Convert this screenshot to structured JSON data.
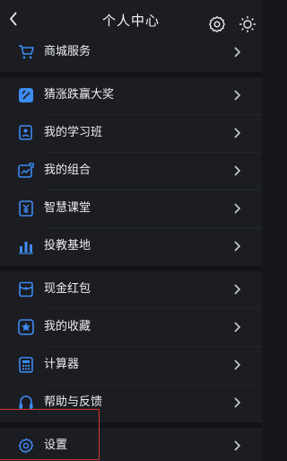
{
  "header": {
    "title": "个人中心",
    "back_icon": "chevron-left-icon",
    "settings_icon": "gear-icon",
    "theme_icon": "sun-icon"
  },
  "menu": {
    "items": [
      {
        "label": "商城服务",
        "icon": "shopping-cart-icon"
      },
      {
        "label": "猜涨跌赢大奖",
        "icon": "prize-icon"
      },
      {
        "label": "我的学习班",
        "icon": "class-icon"
      },
      {
        "label": "我的组合",
        "icon": "portfolio-icon"
      },
      {
        "label": "智慧课堂",
        "icon": "yen-book-icon"
      },
      {
        "label": "投教基地",
        "icon": "bar-chart-icon"
      },
      {
        "label": "现金红包",
        "icon": "wallet-icon"
      },
      {
        "label": "我的收藏",
        "icon": "star-icon"
      },
      {
        "label": "计算器",
        "icon": "calculator-icon"
      },
      {
        "label": "帮助与反馈",
        "icon": "headset-icon"
      },
      {
        "label": "设置",
        "icon": "gear-icon"
      }
    ]
  },
  "colors": {
    "icon_accent": "#3d8bf2",
    "background": "#15171c",
    "row_background": "#1b1d23",
    "highlight_box": "#d9362e"
  }
}
